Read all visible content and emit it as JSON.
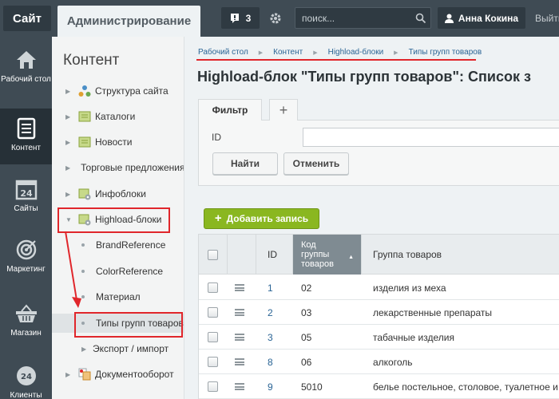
{
  "topbar": {
    "site_label": "Сайт",
    "admin_label": "Администрирование",
    "notifications_count": "3",
    "search_placeholder": "поиск...",
    "user_name": "Анна Кокина",
    "logout_label": "Выйти"
  },
  "leftnav": [
    {
      "label": "Рабочий стол",
      "icon": "home-icon"
    },
    {
      "label": "Контент",
      "icon": "document-icon"
    },
    {
      "label": "Сайты",
      "icon": "calendar-24-icon"
    },
    {
      "label": "Маркетинг",
      "icon": "target-icon"
    },
    {
      "label": "Магазин",
      "icon": "basket-icon"
    },
    {
      "label": "Клиенты",
      "icon": "clock-24-icon"
    }
  ],
  "tree": {
    "title": "Контент",
    "items": [
      {
        "label": "Структура сайта"
      },
      {
        "label": "Каталоги"
      },
      {
        "label": "Новости"
      },
      {
        "label": "Торговые предложения"
      },
      {
        "label": "Инфоблоки"
      },
      {
        "label": "Highload-блоки"
      },
      {
        "label": "BrandReference"
      },
      {
        "label": "ColorReference"
      },
      {
        "label": "Материал"
      },
      {
        "label": "Типы групп товаров"
      },
      {
        "label": "Экспорт / импорт"
      },
      {
        "label": "Документооборот"
      }
    ]
  },
  "breadcrumbs": [
    "Рабочий стол",
    "Контент",
    "Highload-блоки",
    "Типы групп товаров"
  ],
  "page_title": "Highload-блок \"Типы групп товаров\": Список з",
  "filter": {
    "tab_label": "Фильтр",
    "add_tab_label": "+",
    "id_label": "ID",
    "find_label": "Найти",
    "cancel_label": "Отменить"
  },
  "add_record_label": "Добавить запись",
  "table": {
    "columns": [
      "ID",
      "Код группы товаров",
      "Группа товаров"
    ],
    "rows": [
      {
        "id": "1",
        "code": "02",
        "group": "изделия из меха"
      },
      {
        "id": "2",
        "code": "03",
        "group": "лекарственные препараты"
      },
      {
        "id": "3",
        "code": "05",
        "group": "табачные изделия"
      },
      {
        "id": "8",
        "code": "06",
        "group": "алкоголь"
      },
      {
        "id": "9",
        "code": "5010",
        "group": "белье постельное, столовое, туалетное и кухонное"
      }
    ]
  },
  "colors": {
    "accent_green": "#8ab720",
    "annotation_red": "#e0262b",
    "nav_dark": "#3f4b54",
    "link_blue": "#2a6495"
  }
}
